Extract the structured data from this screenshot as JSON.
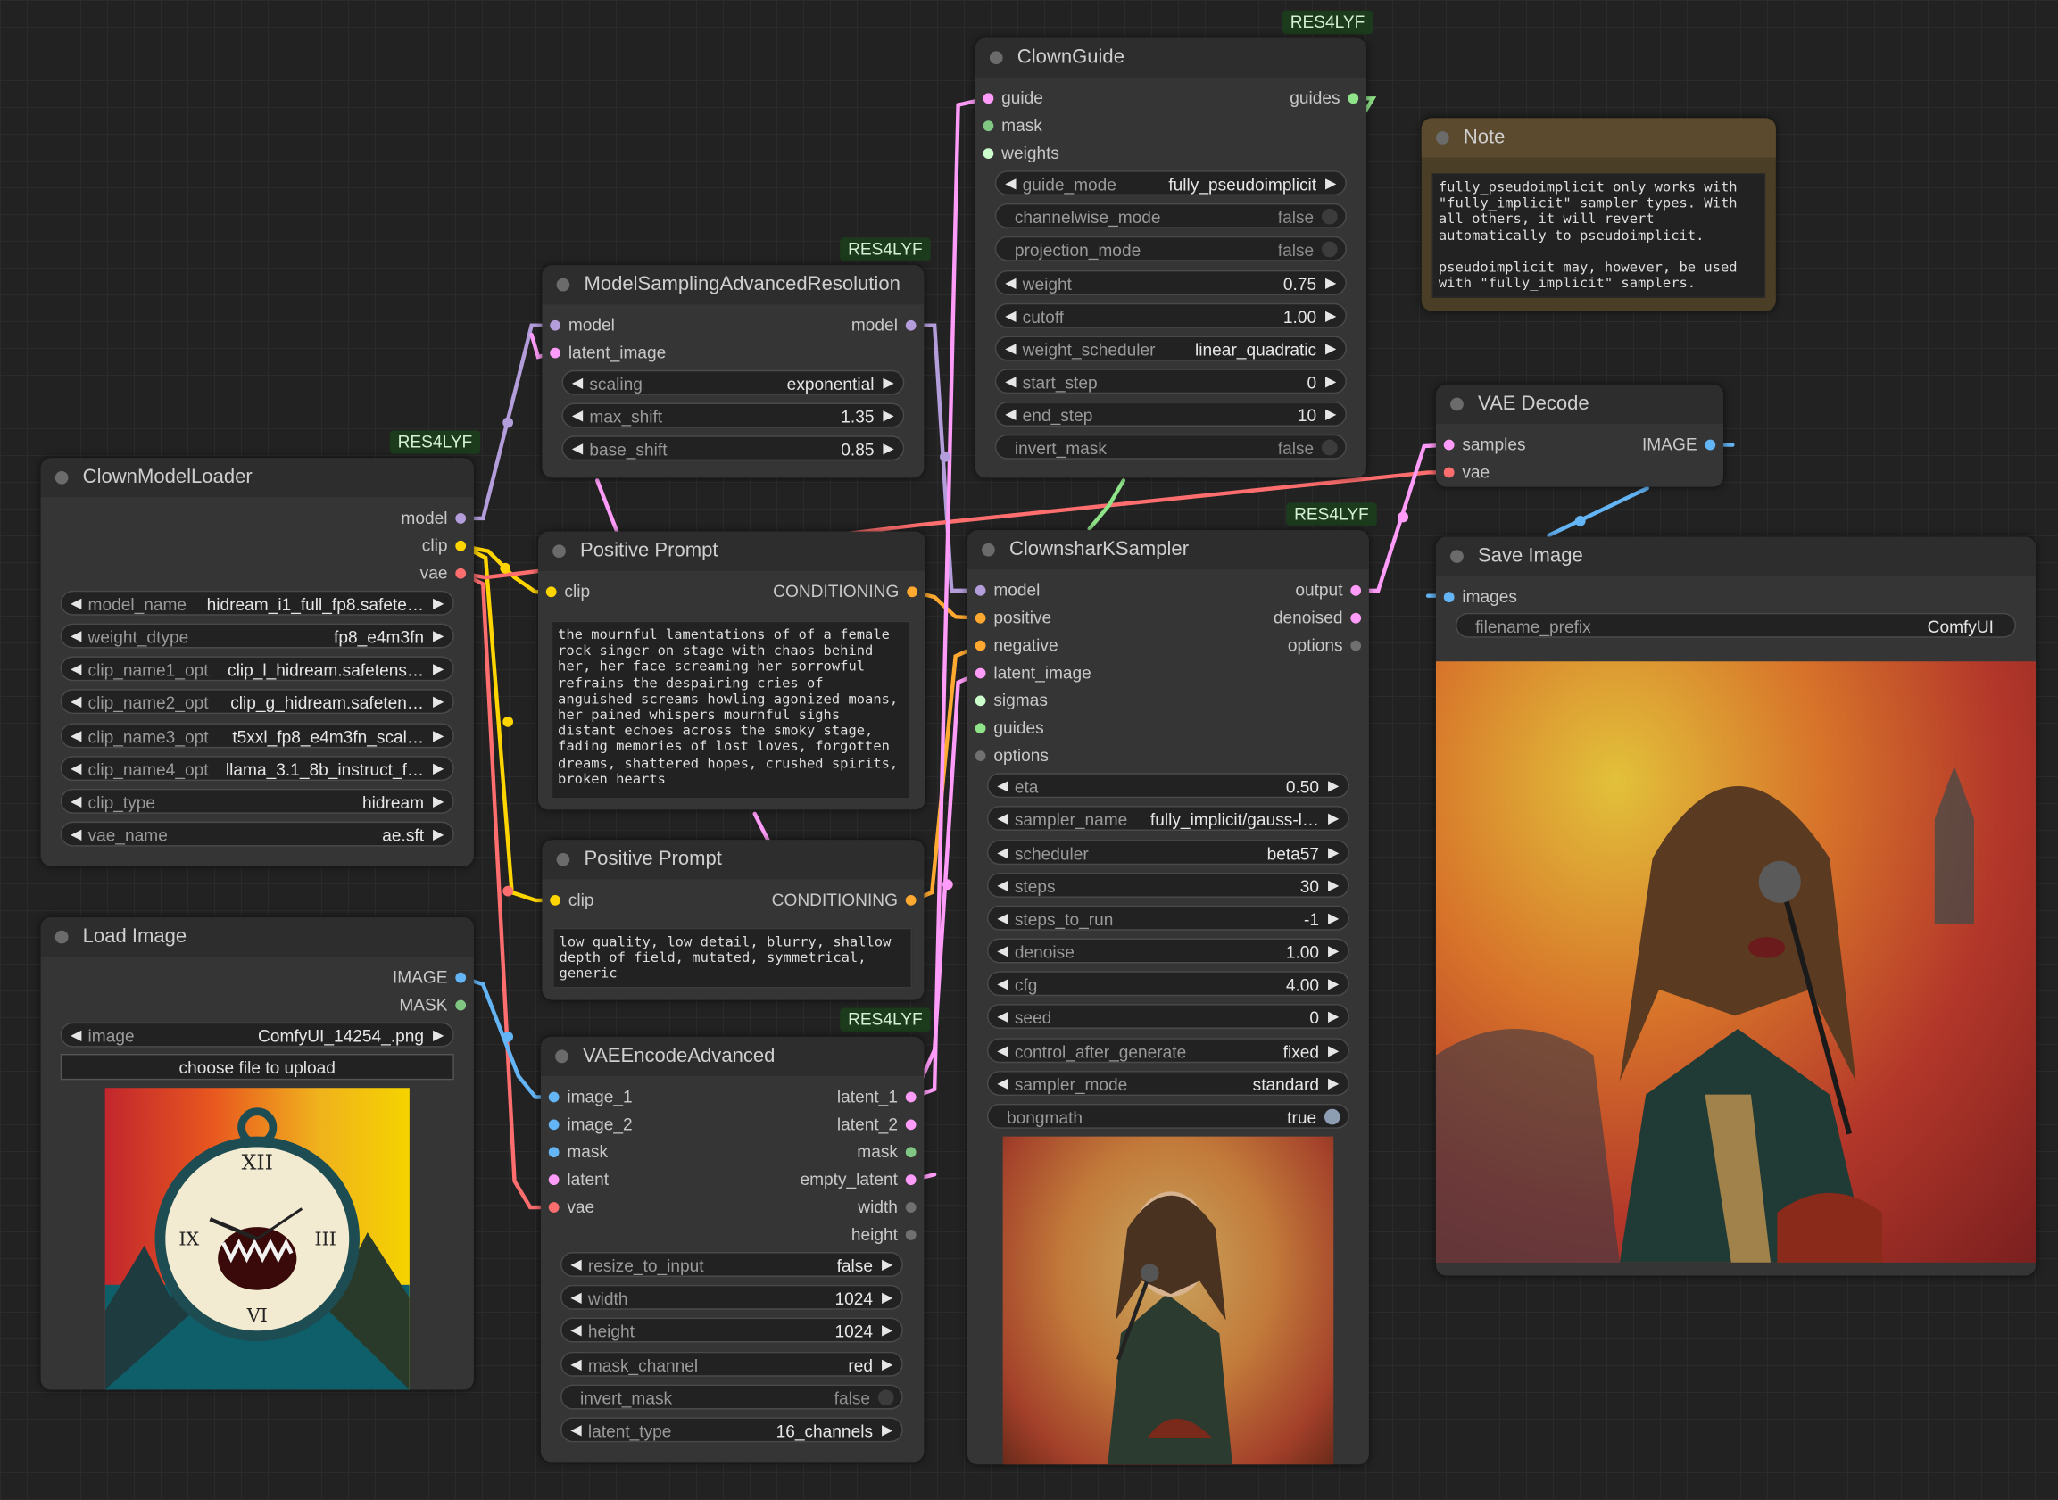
{
  "badge": "RES4LYF",
  "colors": {
    "model": "#b39ddb",
    "clip": "#ffd500",
    "vae": "#ff6e6e",
    "image": "#64b5f6",
    "latent": "#ff9cf9",
    "conditioning": "#ffa931",
    "mask": "#81c784",
    "sigmas": "#cdffcd",
    "guides": "#8fe388",
    "options": "#707070",
    "wire_pink": "#e680e6"
  },
  "clown_model_loader": {
    "title": "ClownModelLoader",
    "outputs": [
      "model",
      "clip",
      "vae"
    ],
    "widgets": [
      {
        "label": "model_name",
        "value": "hidream_i1_full_fp8.safete…"
      },
      {
        "label": "weight_dtype",
        "value": "fp8_e4m3fn"
      },
      {
        "label": "clip_name1_opt",
        "value": "clip_l_hidream.safetens…"
      },
      {
        "label": "clip_name2_opt",
        "value": "clip_g_hidream.safeten…"
      },
      {
        "label": "clip_name3_opt",
        "value": "t5xxl_fp8_e4m3fn_scal…"
      },
      {
        "label": "clip_name4_opt",
        "value": "llama_3.1_8b_instruct_f…"
      },
      {
        "label": "clip_type",
        "value": "hidream"
      },
      {
        "label": "vae_name",
        "value": "ae.sft"
      }
    ]
  },
  "load_image": {
    "title": "Load Image",
    "outputs": [
      "IMAGE",
      "MASK"
    ],
    "image_widget": {
      "label": "image",
      "value": "ComfyUI_14254_.png"
    },
    "upload_button": "choose file to upload"
  },
  "model_sampling": {
    "title": "ModelSamplingAdvancedResolution",
    "inputs": [
      "model",
      "latent_image"
    ],
    "outputs": [
      "model"
    ],
    "widgets": [
      {
        "label": "scaling",
        "value": "exponential"
      },
      {
        "label": "max_shift",
        "value": "1.35"
      },
      {
        "label": "base_shift",
        "value": "0.85"
      }
    ]
  },
  "positive_prompt": {
    "title": "Positive Prompt",
    "input": "clip",
    "output": "CONDITIONING",
    "text": "the mournful lamentations of of a female rock singer on stage with chaos behind her, her face screaming her sorrowful refrains the despairing cries of anguished screams howling agonized moans, her pained whispers mournful sighs distant echoes across the smoky stage, fading memories of lost loves, forgotten dreams, shattered hopes, crushed spirits, broken hearts"
  },
  "negative_prompt": {
    "title": "Positive Prompt",
    "input": "clip",
    "output": "CONDITIONING",
    "text": "low quality, low detail, blurry, shallow depth of field, mutated, symmetrical, generic"
  },
  "vae_encode_advanced": {
    "title": "VAEEncodeAdvanced",
    "inputs": [
      "image_1",
      "image_2",
      "mask",
      "latent",
      "vae"
    ],
    "outputs": [
      "latent_1",
      "latent_2",
      "mask",
      "empty_latent",
      "width",
      "height"
    ],
    "widgets": [
      {
        "label": "resize_to_input",
        "value": "false"
      },
      {
        "label": "width",
        "value": "1024"
      },
      {
        "label": "height",
        "value": "1024"
      },
      {
        "label": "mask_channel",
        "value": "red"
      },
      {
        "label": "invert_mask",
        "value": "false",
        "toggle": true
      },
      {
        "label": "latent_type",
        "value": "16_channels"
      }
    ]
  },
  "clown_guide": {
    "title": "ClownGuide",
    "inputs": [
      "guide",
      "mask",
      "weights"
    ],
    "outputs": [
      "guides"
    ],
    "widgets": [
      {
        "label": "guide_mode",
        "value": "fully_pseudoimplicit"
      },
      {
        "label": "channelwise_mode",
        "value": "false",
        "toggle": true
      },
      {
        "label": "projection_mode",
        "value": "false",
        "toggle": true
      },
      {
        "label": "weight",
        "value": "0.75"
      },
      {
        "label": "cutoff",
        "value": "1.00"
      },
      {
        "label": "weight_scheduler",
        "value": "linear_quadratic"
      },
      {
        "label": "start_step",
        "value": "0"
      },
      {
        "label": "end_step",
        "value": "10"
      },
      {
        "label": "invert_mask",
        "value": "false",
        "toggle": true
      }
    ]
  },
  "clownshark_sampler": {
    "title": "ClownsharKSampler",
    "inputs": [
      "model",
      "positive",
      "negative",
      "latent_image",
      "sigmas",
      "guides",
      "options"
    ],
    "outputs": [
      "output",
      "denoised",
      "options"
    ],
    "widgets": [
      {
        "label": "eta",
        "value": "0.50"
      },
      {
        "label": "sampler_name",
        "value": "fully_implicit/gauss-l…"
      },
      {
        "label": "scheduler",
        "value": "beta57"
      },
      {
        "label": "steps",
        "value": "30"
      },
      {
        "label": "steps_to_run",
        "value": "-1"
      },
      {
        "label": "denoise",
        "value": "1.00"
      },
      {
        "label": "cfg",
        "value": "4.00"
      },
      {
        "label": "seed",
        "value": "0"
      },
      {
        "label": "control_after_generate",
        "value": "fixed"
      },
      {
        "label": "sampler_mode",
        "value": "standard"
      },
      {
        "label": "bongmath",
        "value": "true",
        "toggle": true,
        "on": true
      }
    ]
  },
  "note": {
    "title": "Note",
    "text": "fully_pseudoimplicit only works with \"fully_implicit\" sampler types. With all others, it will revert automatically to pseudoimplicit.\n\npseudoimplicit may, however, be used with \"fully_implicit\" samplers."
  },
  "vae_decode": {
    "title": "VAE Decode",
    "inputs": [
      "samples",
      "vae"
    ],
    "outputs": [
      "IMAGE"
    ]
  },
  "save_image": {
    "title": "Save Image",
    "input": "images",
    "widget": {
      "label": "filename_prefix",
      "value": "ComfyUI"
    }
  }
}
